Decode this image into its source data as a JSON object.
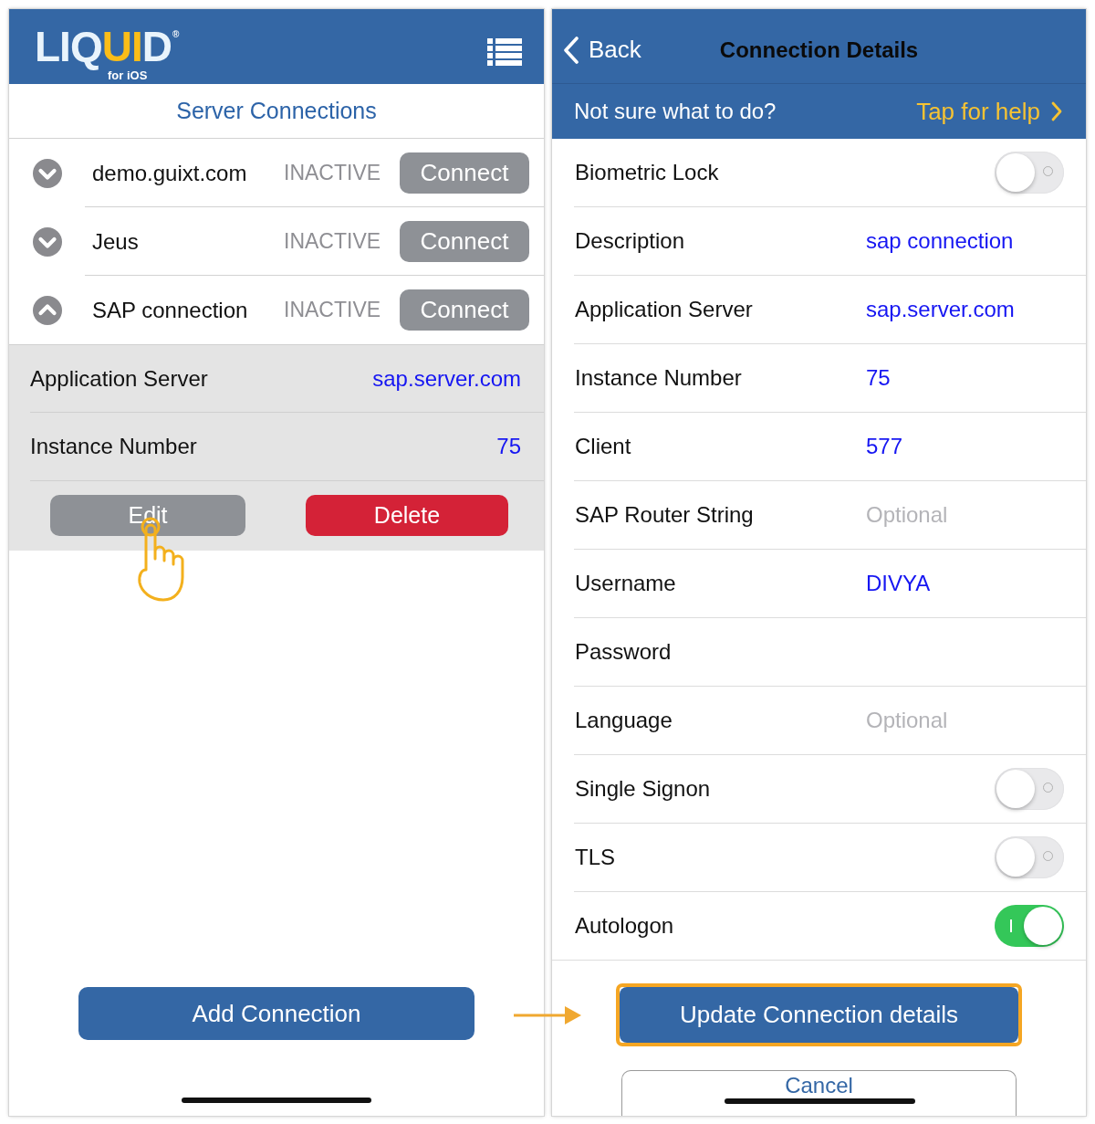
{
  "left_screen": {
    "logo": {
      "parts": [
        {
          "text": "LIQ",
          "highlight": false
        },
        {
          "text": "UI",
          "highlight": true
        },
        {
          "text": "D",
          "highlight": false
        }
      ],
      "mark": "®",
      "tagline": "for iOS"
    },
    "title": "Server Connections",
    "connections": [
      {
        "name": "demo.guixt.com",
        "status": "INACTIVE",
        "button": "Connect",
        "expanded": false
      },
      {
        "name": "Jeus",
        "status": "INACTIVE",
        "button": "Connect",
        "expanded": false
      },
      {
        "name": "SAP connection",
        "status": "INACTIVE",
        "button": "Connect",
        "expanded": true,
        "details": [
          {
            "label": "Application Server",
            "value": "sap.server.com"
          },
          {
            "label": "Instance Number",
            "value": "75"
          }
        ],
        "actions": [
          {
            "label": "Edit",
            "kind": "secondary"
          },
          {
            "label": "Delete",
            "kind": "destructive"
          }
        ]
      }
    ],
    "add_button": "Add Connection"
  },
  "right_screen": {
    "nav": {
      "back": "Back",
      "title": "Connection Details"
    },
    "help": {
      "prompt": "Not sure what to do?",
      "link": "Tap for help"
    },
    "rows": [
      {
        "label": "Biometric Lock",
        "kind": "toggle",
        "on": false
      },
      {
        "label": "Description",
        "kind": "field",
        "value": "sap connection"
      },
      {
        "label": "Application Server",
        "kind": "field",
        "value": "sap.server.com"
      },
      {
        "label": "Instance Number",
        "kind": "field",
        "value": "75"
      },
      {
        "label": "Client",
        "kind": "field",
        "value": "577"
      },
      {
        "label": "SAP Router String",
        "kind": "field",
        "placeholder": "Optional"
      },
      {
        "label": "Username",
        "kind": "field",
        "value": "DIVYA"
      },
      {
        "label": "Password",
        "kind": "field"
      },
      {
        "label": "Language",
        "kind": "field",
        "placeholder": "Optional"
      },
      {
        "label": "Single Signon",
        "kind": "toggle",
        "on": false
      },
      {
        "label": "TLS",
        "kind": "toggle",
        "on": false
      },
      {
        "label": "Autologon",
        "kind": "toggle",
        "on": true
      }
    ],
    "primary_button": {
      "label": "Update Connection details",
      "highlighted": true
    },
    "cancel_button": "Cancel"
  }
}
